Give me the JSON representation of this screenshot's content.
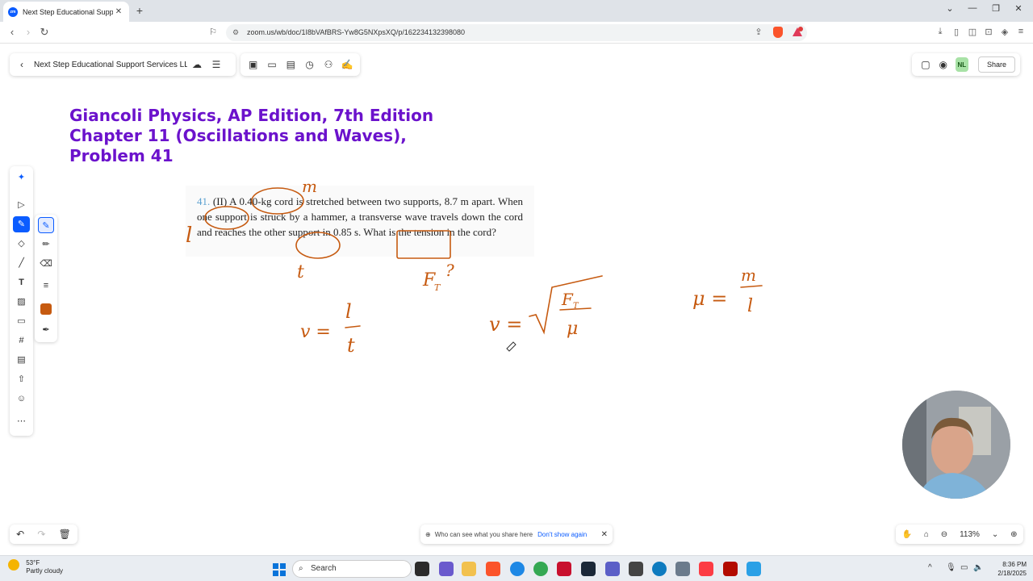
{
  "browser": {
    "tab_title": "Next Step Educational Support",
    "tab_icon": "zoom-icon",
    "url": "zoom.us/wb/doc/1I8bVAfBRS-Yw8G5NXpsXQ/p/162234132398080"
  },
  "whiteboard": {
    "doc_title": "Next Step Educational Support Services LL...",
    "avatar_initials": "NL",
    "share_label": "Share",
    "zoom_level": "113%",
    "pen_color": "#c65a10",
    "notice_text": "Who can see what you share here",
    "notice_link": "Don't show again"
  },
  "heading": {
    "line1": "Giancoli Physics, AP Edition, 7th Edition",
    "line2": "Chapter 11 (Oscillations and Waves),",
    "line3": "Problem 41"
  },
  "problem": {
    "number": "41.",
    "level": "(II)",
    "text": "A 0.40-kg cord is stretched between two supports, 8.7 m apart. When one support is struck by a hammer, a transverse wave travels down the cord and reaches the other support in 0.85 s. What is the tension in the cord?"
  },
  "annotations": {
    "mass_label": "m",
    "length_label": "l",
    "time_label": "t",
    "tension_label": "F",
    "tension_sub": "T",
    "question": "?",
    "eq1_lhs": "v =",
    "eq1_num": "l",
    "eq1_den": "t",
    "eq2_lhs": "v =",
    "eq2_num": "F",
    "eq2_num_sub": "T",
    "eq2_den": "μ",
    "eq3_lhs": "μ =",
    "eq3_num": "m",
    "eq3_den": "l"
  },
  "taskbar": {
    "temperature": "53°F",
    "weather": "Partly cloudy",
    "search_placeholder": "Search",
    "time": "8:36 PM",
    "date": "2/18/2025"
  }
}
